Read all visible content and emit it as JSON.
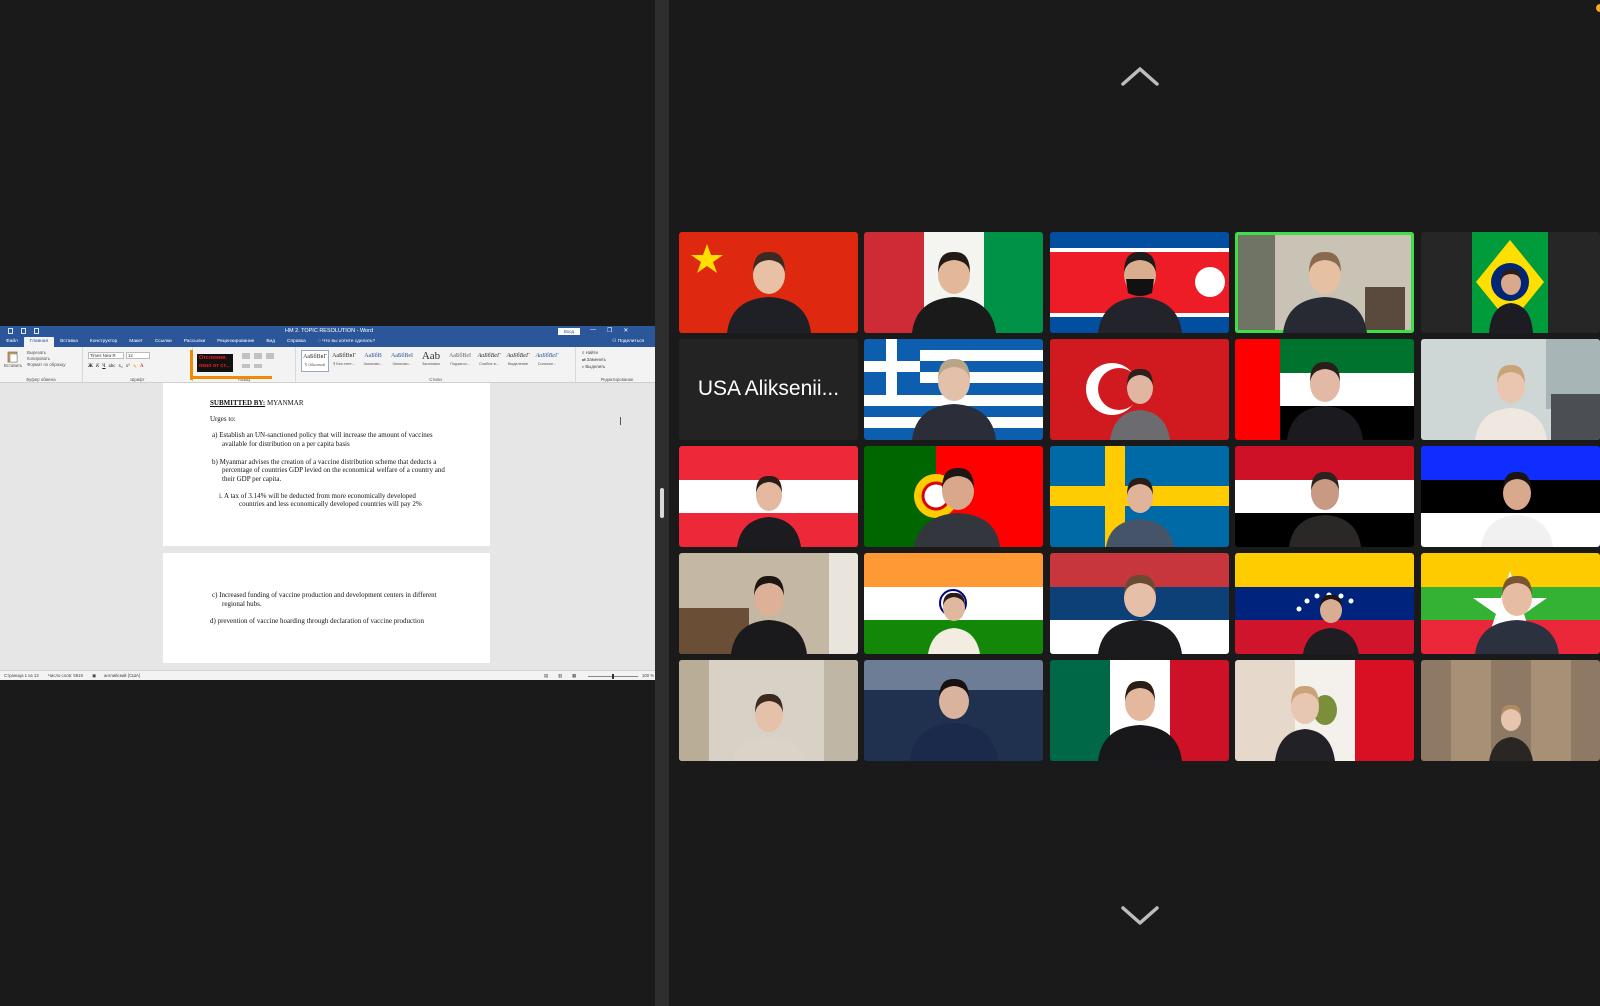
{
  "word": {
    "doc_title": "HM 2. TOPIC RESOLUTION  -  Word",
    "signin": "Вход",
    "window_controls": [
      "—",
      "❐",
      "✕"
    ],
    "tabs": [
      "Файл",
      "Главная",
      "Вставка",
      "Конструктор",
      "Макет",
      "Ссылки",
      "Рассылки",
      "Рецензирование",
      "Вид",
      "Справка"
    ],
    "tell_me": "Что вы хотите сделать?",
    "share": "Поделиться",
    "ribbon": {
      "paste": "Вставить",
      "cut": "Вырезать",
      "copy": "Копировать",
      "format_painter": "Формат по образцу",
      "clipboard_group": "Буфер обмена",
      "font_group": "Шрифт",
      "paragraph_group": "Абзац",
      "styles_group": "Стили",
      "editing_group": "Редактирование",
      "font_name": "Times New R",
      "font_size": "12",
      "tooltip_lines": [
        "Отслежив.",
        "окно от ст..."
      ],
      "styles": [
        {
          "sample": "АаБбВвГ",
          "name": "¶ Обычный"
        },
        {
          "sample": "АаБбВвГ",
          "name": "¶ Без инте..."
        },
        {
          "sample": "АаБбВ",
          "name": "Заголово..."
        },
        {
          "sample": "АаБбВеI",
          "name": "Заголово..."
        },
        {
          "sample": "Aab",
          "name": "Заголовок"
        },
        {
          "sample": "АаБбВеI",
          "name": "Подзагол..."
        },
        {
          "sample": "АаБбВеГ",
          "name": "Слабое в..."
        },
        {
          "sample": "АаБбВеГ",
          "name": "Выделение"
        },
        {
          "sample": "АаБбВеГ",
          "name": "Сильное..."
        }
      ],
      "find": "Найти",
      "replace": "Заменить",
      "select": "Выделить"
    },
    "document": {
      "submitted_label": "SUBMITTED BY:",
      "submitted_value": "MYANMAR",
      "urges": "Urges to:",
      "item_a_1": "a)   Establish an UN-sanctioned policy that will increase the amount of vaccines",
      "item_a_2": "available for distribution on a per capita basis",
      "item_b_1": "b)   Myanmar advises the creation of a vaccine distribution scheme that deducts a",
      "item_b_2": "percentage of countries GDP levied on the economical welfare of a country and",
      "item_b_3": "their GDP per capita.",
      "item_i_1": "i.          A tax of 3.14% will be deducted from more economically developed",
      "item_i_2": "countries and less economically developed countries will pay 2%",
      "item_c_1": "c)   Increased funding of vaccine production and development centers in different",
      "item_c_2": "regional hubs.",
      "item_d": "d) prevention of vaccine hoarding through declaration of vaccine production"
    },
    "status": {
      "page": "Страница 1 из 13",
      "words": "Число слов: 5919",
      "language": "английский (США)",
      "zoom": "100 %"
    }
  },
  "gallery": {
    "tiles": [
      {
        "flag": "china"
      },
      {
        "flag": "italy"
      },
      {
        "flag": "north-korea"
      },
      {
        "flag": "none",
        "speaking": true
      },
      {
        "flag": "brazil"
      },
      {
        "flag": "none",
        "name": "USA Aliksenii..."
      },
      {
        "flag": "greece"
      },
      {
        "flag": "turkey"
      },
      {
        "flag": "uae"
      },
      {
        "flag": "none"
      },
      {
        "flag": "austria"
      },
      {
        "flag": "portugal"
      },
      {
        "flag": "sweden"
      },
      {
        "flag": "yemen"
      },
      {
        "flag": "estonia"
      },
      {
        "flag": "none"
      },
      {
        "flag": "india"
      },
      {
        "flag": "serbia"
      },
      {
        "flag": "venezuela"
      },
      {
        "flag": "myanmar"
      },
      {
        "flag": "none"
      },
      {
        "flag": "none"
      },
      {
        "flag": "mexico"
      },
      {
        "flag": "peru"
      },
      {
        "flag": "none"
      }
    ]
  }
}
